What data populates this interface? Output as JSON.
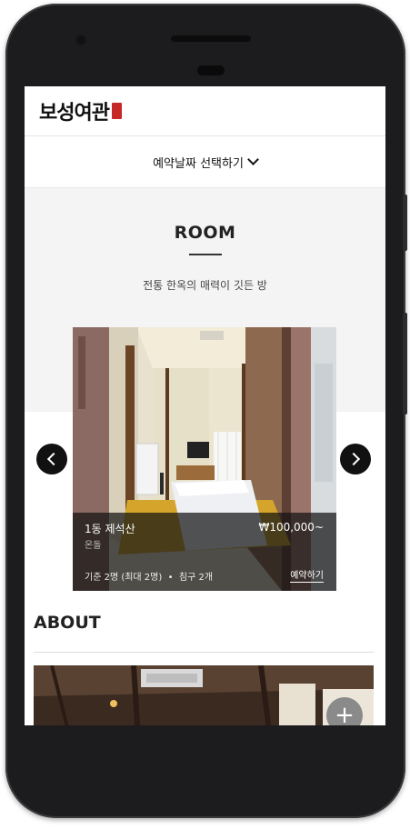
{
  "header": {
    "logo_text": "보성여관"
  },
  "date_selector": {
    "label": "예약날짜 선택하기"
  },
  "room_section": {
    "title": "ROOM",
    "subtitle": "전통 한옥의 매력이 깃든 방"
  },
  "room_card": {
    "name": "1동 제석산",
    "type": "온돌",
    "price": "₩100,000~",
    "capacity": "기준 2명 (최대 2명)",
    "bedding": "침구 2개",
    "book_label": "예약하기"
  },
  "about": {
    "title": "ABOUT"
  },
  "colors": {
    "text": "#222222",
    "section_bg": "#f4f4f4",
    "seal": "#c62828"
  },
  "icons": [
    "chevron-down-icon",
    "chevron-left-icon",
    "chevron-right-icon",
    "plus-icon"
  ]
}
